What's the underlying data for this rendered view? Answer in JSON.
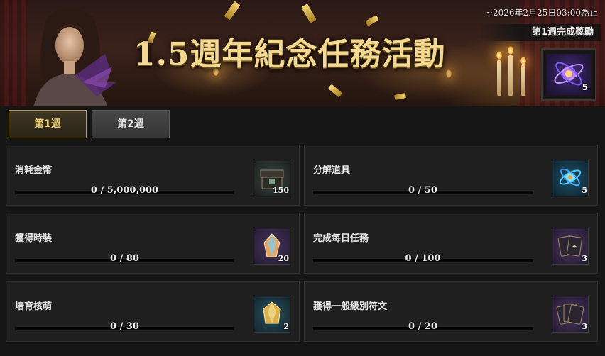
{
  "banner": {
    "title": "1.5週年紀念任務活動",
    "deadline": "~2026年2月25日03:00為止",
    "reward_label": "第1週完成獎勵",
    "reward_count": "5",
    "reward_icon": "purple-orb-icon"
  },
  "tabs": [
    {
      "label": "第1週",
      "active": true
    },
    {
      "label": "第2週",
      "active": false
    }
  ],
  "quests": [
    {
      "title": "消耗金幣",
      "progress": "0 / 5,000,000",
      "fraction": 0,
      "reward_qty": "150",
      "icon": "chest-icon"
    },
    {
      "title": "分解道具",
      "progress": "0 / 50",
      "fraction": 0,
      "reward_qty": "5",
      "icon": "cyan-orb-icon"
    },
    {
      "title": "獲得時裝",
      "progress": "0 / 80",
      "fraction": 0,
      "reward_qty": "20",
      "icon": "crystal-icon"
    },
    {
      "title": "完成每日任務",
      "progress": "0 / 100",
      "fraction": 0,
      "reward_qty": "3",
      "icon": "cards-icon"
    },
    {
      "title": "培育核萌",
      "progress": "0 / 30",
      "fraction": 0,
      "reward_qty": "2",
      "icon": "gold-crystal-icon"
    },
    {
      "title": "獲得一般級別符文",
      "progress": "0 / 20",
      "fraction": 0,
      "reward_qty": "3",
      "icon": "rune-cards-icon"
    }
  ],
  "colors": {
    "accent": "#f1d37a",
    "panel": "#1f1f1f",
    "bar_fill": "#c9a24a"
  }
}
